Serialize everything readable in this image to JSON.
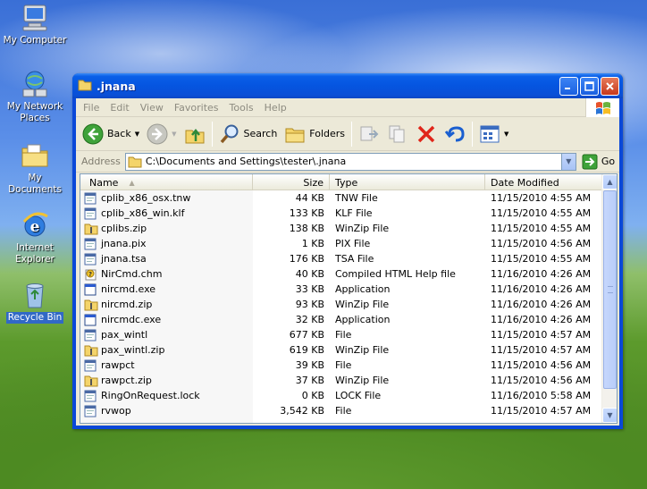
{
  "desktop": {
    "icons": [
      {
        "label": "My Computer",
        "icon": "my-computer-icon"
      },
      {
        "label": "My Network Places",
        "icon": "network-places-icon"
      },
      {
        "label": "My Documents",
        "icon": "my-documents-icon"
      },
      {
        "label": "Internet Explorer",
        "icon": "internet-explorer-icon"
      },
      {
        "label": "Recycle Bin",
        "icon": "recycle-bin-icon"
      }
    ]
  },
  "window": {
    "title": ".jnana",
    "menu": [
      "File",
      "Edit",
      "View",
      "Favorites",
      "Tools",
      "Help"
    ],
    "toolbar": {
      "back_label": "Back",
      "search_label": "Search",
      "folders_label": "Folders"
    },
    "address": {
      "label": "Address",
      "value": "C:\\Documents and Settings\\tester\\.jnana",
      "go_label": "Go"
    },
    "columns": {
      "name": "Name",
      "size": "Size",
      "type": "Type",
      "date": "Date Modified"
    },
    "files": [
      {
        "name": "cplib_x86_osx.tnw",
        "size": "44 KB",
        "type": "TNW File",
        "date": "11/15/2010 4:55 AM",
        "icon": "generic-file-icon"
      },
      {
        "name": "cplib_x86_win.klf",
        "size": "133 KB",
        "type": "KLF File",
        "date": "11/15/2010 4:55 AM",
        "icon": "generic-file-icon"
      },
      {
        "name": "cplibs.zip",
        "size": "138 KB",
        "type": "WinZip File",
        "date": "11/15/2010 4:55 AM",
        "icon": "zip-file-icon"
      },
      {
        "name": "jnana.pix",
        "size": "1 KB",
        "type": "PIX File",
        "date": "11/15/2010 4:56 AM",
        "icon": "generic-file-icon"
      },
      {
        "name": "jnana.tsa",
        "size": "176 KB",
        "type": "TSA File",
        "date": "11/15/2010 4:55 AM",
        "icon": "generic-file-icon"
      },
      {
        "name": "NirCmd.chm",
        "size": "40 KB",
        "type": "Compiled HTML Help file",
        "date": "11/16/2010 4:26 AM",
        "icon": "help-file-icon"
      },
      {
        "name": "nircmd.exe",
        "size": "33 KB",
        "type": "Application",
        "date": "11/16/2010 4:26 AM",
        "icon": "application-icon"
      },
      {
        "name": "nircmd.zip",
        "size": "93 KB",
        "type": "WinZip File",
        "date": "11/16/2010 4:26 AM",
        "icon": "zip-file-icon"
      },
      {
        "name": "nircmdc.exe",
        "size": "32 KB",
        "type": "Application",
        "date": "11/16/2010 4:26 AM",
        "icon": "application-icon"
      },
      {
        "name": "pax_wintl",
        "size": "677 KB",
        "type": "File",
        "date": "11/15/2010 4:57 AM",
        "icon": "generic-file-icon"
      },
      {
        "name": "pax_wintl.zip",
        "size": "619 KB",
        "type": "WinZip File",
        "date": "11/15/2010 4:57 AM",
        "icon": "zip-file-icon"
      },
      {
        "name": "rawpct",
        "size": "39 KB",
        "type": "File",
        "date": "11/15/2010 4:56 AM",
        "icon": "generic-file-icon"
      },
      {
        "name": "rawpct.zip",
        "size": "37 KB",
        "type": "WinZip File",
        "date": "11/15/2010 4:56 AM",
        "icon": "zip-file-icon"
      },
      {
        "name": "RingOnRequest.lock",
        "size": "0 KB",
        "type": "LOCK File",
        "date": "11/16/2010 5:58 AM",
        "icon": "generic-file-icon"
      },
      {
        "name": "rvwop",
        "size": "3,542 KB",
        "type": "File",
        "date": "11/15/2010 4:57 AM",
        "icon": "generic-file-icon"
      }
    ]
  }
}
